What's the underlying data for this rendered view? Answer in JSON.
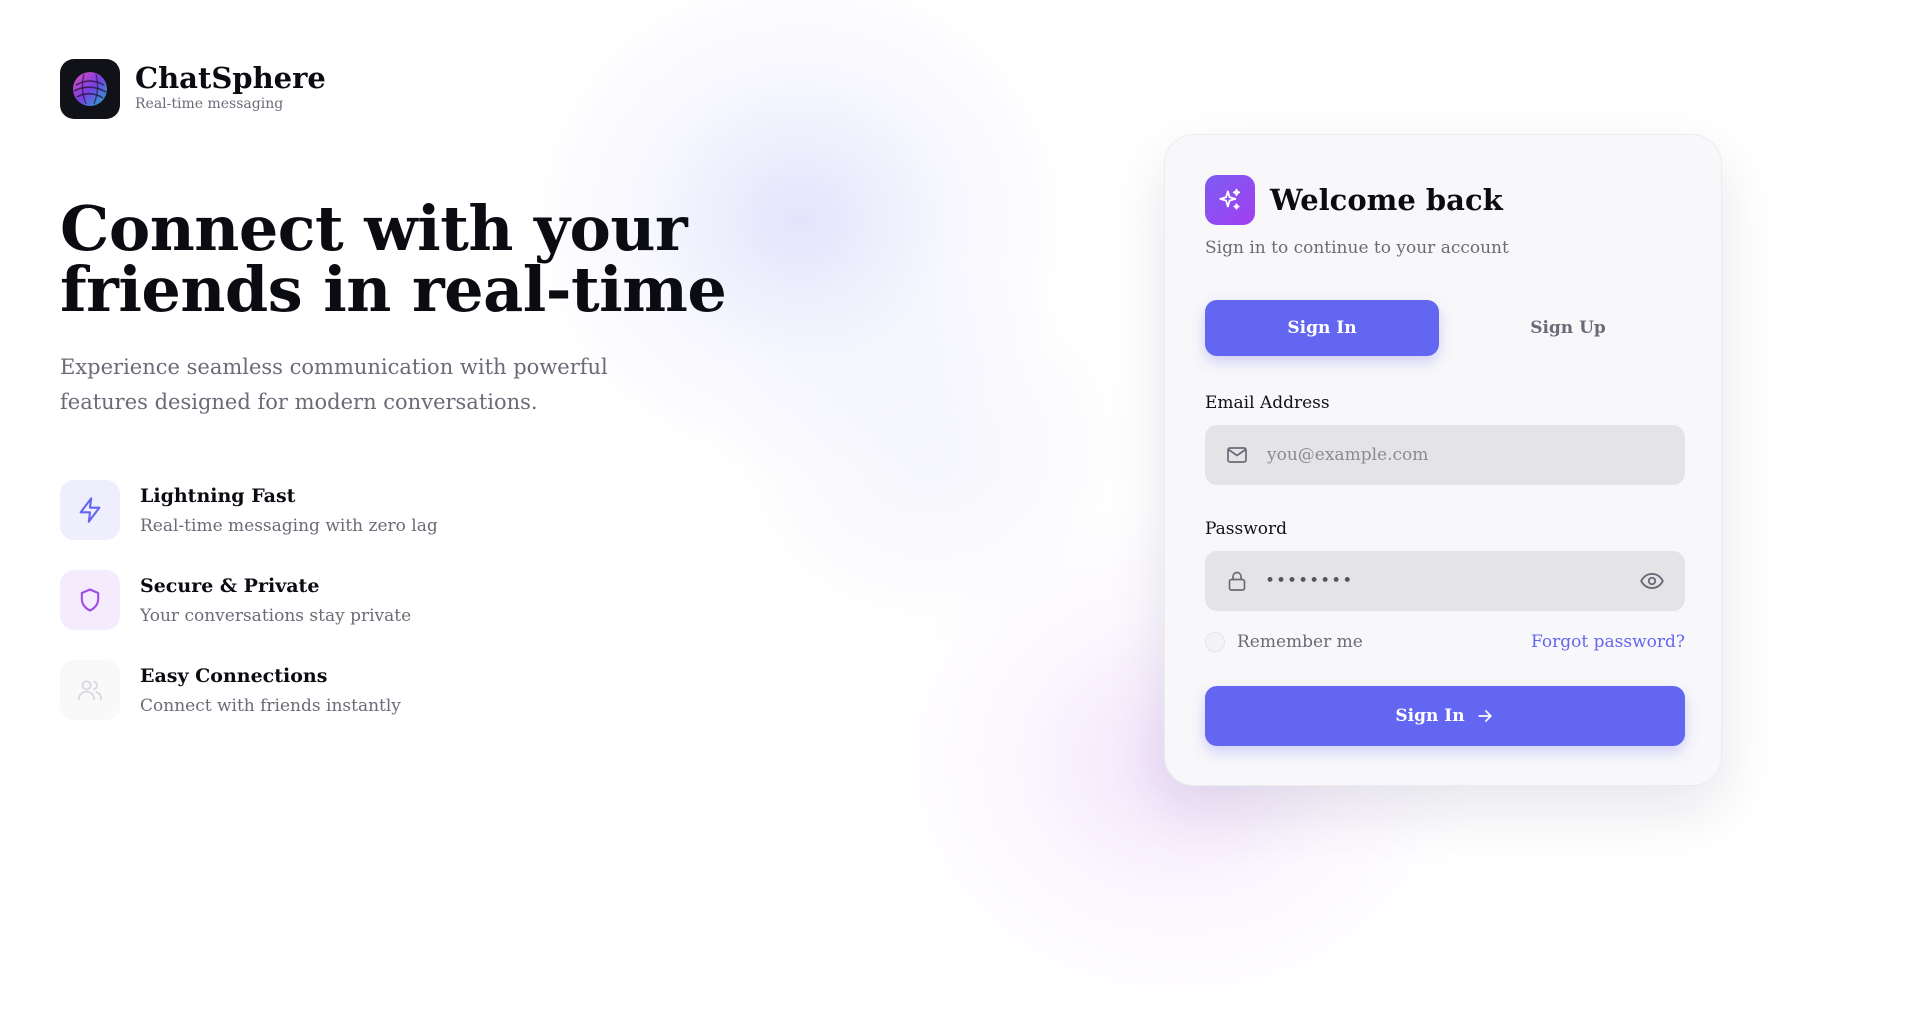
{
  "brand": {
    "name": "ChatSphere",
    "tagline": "Real-time messaging"
  },
  "hero": {
    "title": "Connect with your friends in real-time",
    "subtitle": "Experience seamless communication with powerful features designed for modern conversations."
  },
  "features": [
    {
      "icon": "lightning-icon",
      "title": "Lightning Fast",
      "description": "Real-time messaging with zero lag",
      "color": "#6366f1"
    },
    {
      "icon": "shield-icon",
      "title": "Secure & Private",
      "description": "Your conversations stay private",
      "color": "#9d4de8"
    },
    {
      "icon": "users-icon",
      "title": "Easy Connections",
      "description": "Connect with friends instantly",
      "color": "#d8d8de"
    }
  ],
  "auth": {
    "title": "Welcome back",
    "subtitle": "Sign in to continue to your account",
    "tabs": {
      "signin": "Sign In",
      "signup": "Sign Up",
      "active": "signin"
    },
    "email": {
      "label": "Email Address",
      "value": "",
      "placeholder": "you@example.com"
    },
    "password": {
      "label": "Password",
      "value": "••••••••"
    },
    "remember": {
      "label": "Remember me",
      "checked": false
    },
    "forgot": "Forgot password?",
    "submit": "Sign In"
  },
  "colors": {
    "accent": "#6366f1",
    "accent_purple": "#9d4de8",
    "muted_text": "#6b6b78",
    "field_bg": "#e4e4e7"
  }
}
